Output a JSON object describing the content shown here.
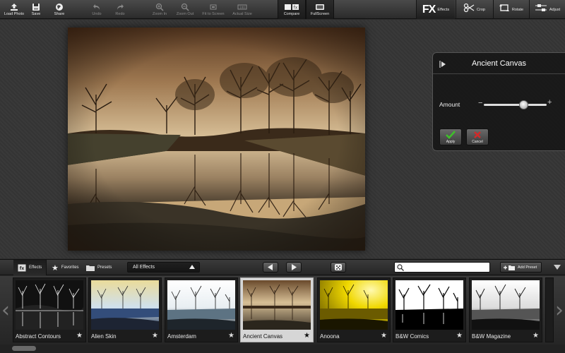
{
  "toolbar": {
    "left": [
      {
        "name": "load-photo",
        "label": "Load Photo"
      },
      {
        "name": "save",
        "label": "Save"
      },
      {
        "name": "share",
        "label": "Share"
      },
      {
        "name": "undo",
        "label": "Undo"
      },
      {
        "name": "redo",
        "label": "Redo"
      },
      {
        "name": "zoom-in",
        "label": "Zoom In"
      },
      {
        "name": "zoom-out",
        "label": "Zoom Out"
      },
      {
        "name": "fit-to-screen",
        "label": "Fit to Screen"
      },
      {
        "name": "actual-size",
        "label": "Actual Size"
      },
      {
        "name": "compare",
        "label": "Compare"
      },
      {
        "name": "fullscreen",
        "label": "FullScreen"
      }
    ],
    "right": {
      "effects_mark": "FX",
      "effects_label": "Effects",
      "crop_label": "Crop",
      "rotate_label": "Rotate",
      "adjust_label": "Adjust"
    }
  },
  "panel": {
    "title": "Ancient Canvas",
    "amount_label": "Amount",
    "amount_minus": "−",
    "amount_plus": "+",
    "amount_value": 0.64,
    "apply_label": "Apply",
    "cancel_label": "Cancel"
  },
  "bottombar": {
    "tabs": {
      "effects": "Effects",
      "favorites": "Favorites",
      "presets": "Presets"
    },
    "filter_selected": "All Effects",
    "search": {
      "value": "",
      "placeholder": ""
    },
    "add_preset": "Add Preset"
  },
  "effects": [
    {
      "name": "Abstract Contours"
    },
    {
      "name": "Alien Skin"
    },
    {
      "name": "Amsterdam"
    },
    {
      "name": "Ancient Canvas"
    },
    {
      "name": "Anoona"
    },
    {
      "name": "B&W Comics"
    },
    {
      "name": "B&W Magazine"
    }
  ],
  "colors": {
    "accent_apply": "#3fbf2a",
    "accent_cancel": "#d12a2a",
    "selected_thumb": "#d6d6d6"
  }
}
